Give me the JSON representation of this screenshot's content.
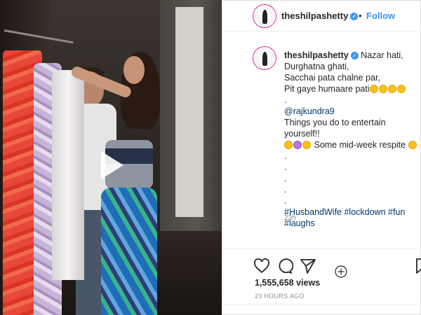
{
  "header": {
    "username": "theshilpashetty",
    "separator": "•",
    "follow_label": "Follow"
  },
  "caption": {
    "username": "theshilpashetty",
    "line1": "Nazar hati,",
    "line2": "Durghatna ghati,",
    "line3": "Sacchai pata chalne par,",
    "line4": "Pit gaye humaare pati",
    "dot_lines": [
      "."
    ],
    "mention": "@rajkundra9",
    "line5": "Things you do to entertain yourself!!",
    "line6": "Some mid-week respite",
    "dots": [
      ".",
      ".",
      ".",
      ".",
      "."
    ],
    "hashtags": "#HusbandWife #lockdown #fun #laughs",
    "time_ago": "23h"
  },
  "stats": {
    "views": "1,555,658 views",
    "date": "23 HOURS AGO"
  },
  "icons": {
    "play": "play-icon",
    "like": "heart-icon",
    "comment": "comment-icon",
    "share": "share-icon",
    "save": "bookmark-icon",
    "add": "add-comment-icon"
  },
  "colors": {
    "accent": "#3897f0",
    "text": "#262626",
    "muted": "#8e8e8e",
    "link": "#00376b"
  }
}
